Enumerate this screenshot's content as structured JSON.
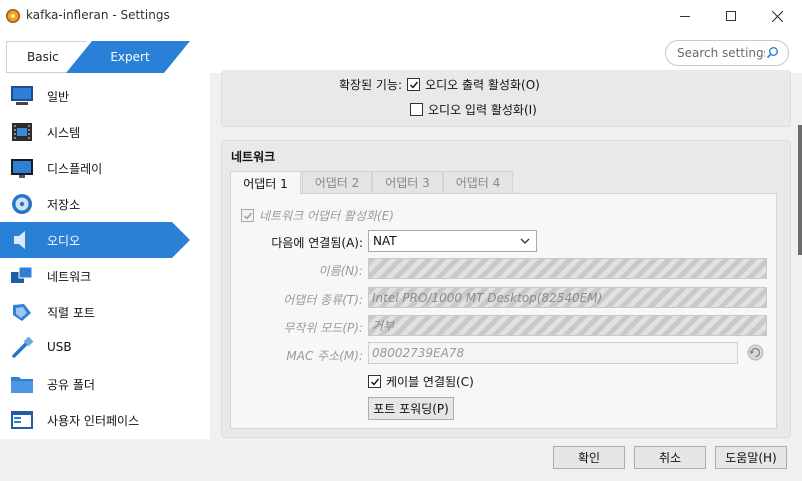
{
  "window": {
    "title": "kafka-infleran - Settings"
  },
  "mode_tabs": {
    "basic": "Basic",
    "expert": "Expert",
    "active": "Expert"
  },
  "search": {
    "placeholder": "Search settings"
  },
  "sidebar": {
    "active": "오디오",
    "items": [
      {
        "label": "일반",
        "icon": "general-icon"
      },
      {
        "label": "시스템",
        "icon": "system-icon"
      },
      {
        "label": "디스플레이",
        "icon": "display-icon"
      },
      {
        "label": "저장소",
        "icon": "storage-icon"
      },
      {
        "label": "오디오",
        "icon": "audio-icon"
      },
      {
        "label": "네트워크",
        "icon": "network-icon"
      },
      {
        "label": "직렬 포트",
        "icon": "serial-port-icon"
      },
      {
        "label": "USB",
        "icon": "usb-icon"
      },
      {
        "label": "공유 폴더",
        "icon": "shared-folder-icon"
      },
      {
        "label": "사용자 인터페이스",
        "icon": "user-interface-icon"
      }
    ]
  },
  "audio": {
    "extended_label": "확장된 기능:",
    "output_label": "오디오 출력 활성화(O)",
    "output_checked": true,
    "input_label": "오디오 입력 활성화(I)",
    "input_checked": false
  },
  "network": {
    "title": "네트워크",
    "tabs": [
      "어댑터 1",
      "어댑터 2",
      "어댑터 3",
      "어댑터 4"
    ],
    "active_tab": "어댑터 1",
    "enable_label": "네트워크 어댑터 활성화(E)",
    "enable_checked": true,
    "attached_label": "다음에 연결됨(A):",
    "attached_value": "NAT",
    "name_label": "이름(N):",
    "name_value": "",
    "adapter_type_label": "어댑터 종류(T):",
    "adapter_type_value": "Intel PRO/1000 MT Desktop(82540EM)",
    "promiscuous_label": "무작위 모드(P):",
    "promiscuous_value": "거부",
    "mac_label": "MAC 주소(M):",
    "mac_value": "08002739EA78",
    "cable_label": "케이블 연결됨(C)",
    "cable_checked": true,
    "port_forwarding_label": "포트 포워딩(P)"
  },
  "buttons": {
    "ok": "확인",
    "cancel": "취소",
    "help": "도움말(H)"
  },
  "colors": {
    "accent": "#2a7fd6",
    "panel": "#e9e9e9"
  }
}
